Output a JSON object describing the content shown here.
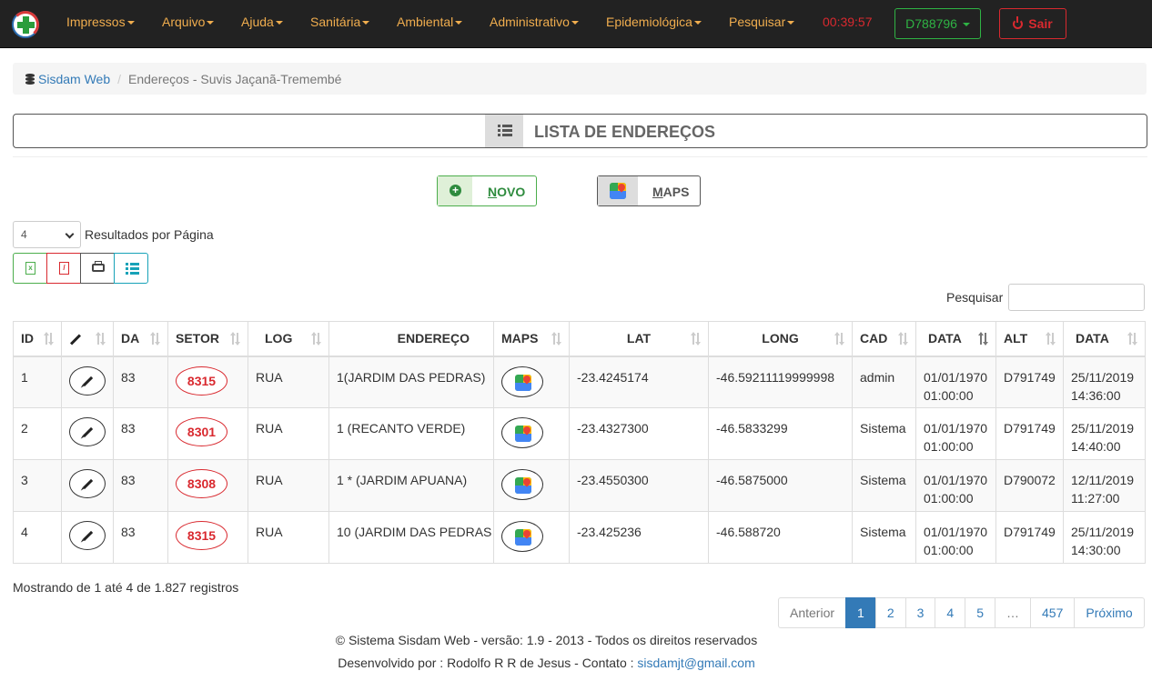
{
  "nav": {
    "menu": [
      {
        "label": "Impressos"
      },
      {
        "label": "Arquivo"
      },
      {
        "label": "Ajuda"
      },
      {
        "label": "Sanitária"
      },
      {
        "label": "Ambiental"
      },
      {
        "label": "Administrativo"
      },
      {
        "label": "Epidemiológica"
      },
      {
        "label": "Pesquisar"
      }
    ],
    "timer": "00:39:57",
    "user": "D788796",
    "exit": "Sair"
  },
  "breadcrumb": {
    "home": "Sisdam Web",
    "current": "Endereços - Suvis Jaçanã-Tremembé"
  },
  "panel_title": "LISTA DE ENDEREÇOS",
  "actions": {
    "new_first": "N",
    "new_rest": "OVO",
    "maps_first": "M",
    "maps_rest": "APS"
  },
  "length": {
    "value": "4",
    "label": "Resultados por Página"
  },
  "search_label": "Pesquisar",
  "table": {
    "headers": [
      "ID",
      "",
      "DA",
      "SETOR",
      "LOG",
      "ENDEREÇO",
      "MAPS",
      "LAT",
      "LONG",
      "CAD",
      "DATA",
      "ALT",
      "DATA"
    ],
    "rows": [
      {
        "id": "1",
        "da": "83",
        "setor": "8315",
        "log": "RUA",
        "endereco": "1(JARDIM DAS PEDRAS)",
        "lat": "-23.4245174",
        "long": "-46.59211119999998",
        "cad": "admin",
        "data1_d": "01/01/1970",
        "data1_t": "01:00:00",
        "alt": "D791749",
        "data2_d": "25/11/2019",
        "data2_t": "14:36:00"
      },
      {
        "id": "2",
        "da": "83",
        "setor": "8301",
        "log": "RUA",
        "endereco": "1 (RECANTO VERDE)",
        "lat": "-23.4327300",
        "long": "-46.5833299",
        "cad": "Sistema",
        "data1_d": "01/01/1970",
        "data1_t": "01:00:00",
        "alt": "D791749",
        "data2_d": "25/11/2019",
        "data2_t": "14:40:00"
      },
      {
        "id": "3",
        "da": "83",
        "setor": "8308",
        "log": "RUA",
        "endereco": "1 * (JARDIM APUANA)",
        "lat": "-23.4550300",
        "long": "-46.5875000",
        "cad": "Sistema",
        "data1_d": "01/01/1970",
        "data1_t": "01:00:00",
        "alt": "D790072",
        "data2_d": "12/11/2019",
        "data2_t": "11:27:00"
      },
      {
        "id": "4",
        "da": "83",
        "setor": "8315",
        "log": "RUA",
        "endereco": "10 (JARDIM DAS PEDRAS",
        "lat": "-23.425236",
        "long": "-46.588720",
        "cad": "Sistema",
        "data1_d": "01/01/1970",
        "data1_t": "01:00:00",
        "alt": "D791749",
        "data2_d": "25/11/2019",
        "data2_t": "14:30:00"
      }
    ]
  },
  "info": "Mostrando de 1 até 4 de 1.827 registros",
  "pagination": [
    "Anterior",
    "1",
    "2",
    "3",
    "4",
    "5",
    "…",
    "457",
    "Próximo"
  ],
  "footer": {
    "line1": "© Sistema Sisdam Web - versão: 1.9 - 2013 - Todos os direitos reservados",
    "line2_prefix": "Desenvolvido por : Rodolfo R R de Jesus - Contato : ",
    "email": "sisdamjt@gmail.com"
  },
  "colors": {
    "navbar": "#222222",
    "menu": "#f0ad4e",
    "timer": "#d9292f",
    "user": "#2fb344",
    "danger": "#d9292f",
    "primary": "#337ab7"
  }
}
